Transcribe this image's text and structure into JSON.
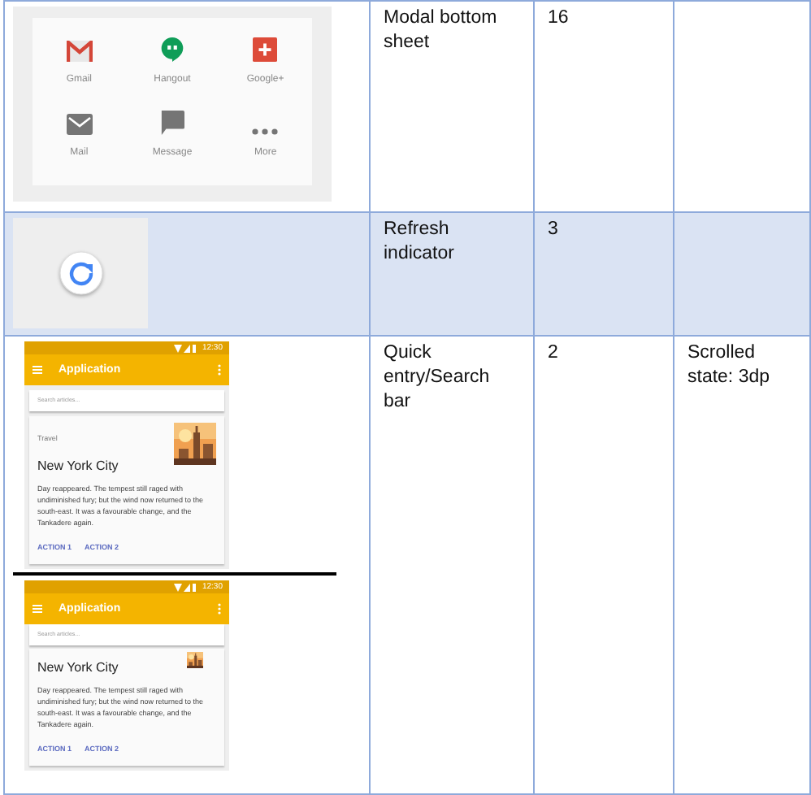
{
  "table": {
    "rows": [
      {
        "shaded": false,
        "component": "Modal bottom sheet",
        "dp": "16",
        "previews": [
          {
            "kind": "share_sheet",
            "items": [
              {
                "label": "Gmail"
              },
              {
                "label": "Hangout"
              },
              {
                "label": "Google+"
              },
              {
                "label": "Mail"
              },
              {
                "label": "Message"
              },
              {
                "label": "More"
              }
            ]
          }
        ]
      },
      {
        "shaded": true,
        "component": "Refresh indicator",
        "dp": "3",
        "previews": [
          {
            "kind": "refresh"
          }
        ]
      },
      {
        "shaded": false,
        "component": "Quick entry/Search bar",
        "dp": "2",
        "note": "Scrolled state: 3dp",
        "previews": [
          {
            "kind": "phone",
            "scrolled": false,
            "time": "12:30",
            "app_title": "Application",
            "search_placeholder": "Search articles...",
            "card": {
              "category": "Travel",
              "title": "New York City",
              "body": "Day reappeared. The tempest still raged with undiminished fury; but the wind now returned to the south-east. It was a favourable change, and the Tankadere again.",
              "actions": [
                "ACTION 1",
                "ACTION 2"
              ]
            }
          },
          {
            "kind": "phone",
            "scrolled": true,
            "time": "12:30",
            "app_title": "Application",
            "search_placeholder": "Search articles...",
            "card": {
              "title": "New York City",
              "body": "Day reappeared. The tempest still raged with undiminished fury; but the wind now returned to the south-east. It was a favourable change, and the Tankadere again.",
              "actions": [
                "ACTION 1",
                "ACTION 2"
              ]
            }
          }
        ]
      }
    ]
  }
}
